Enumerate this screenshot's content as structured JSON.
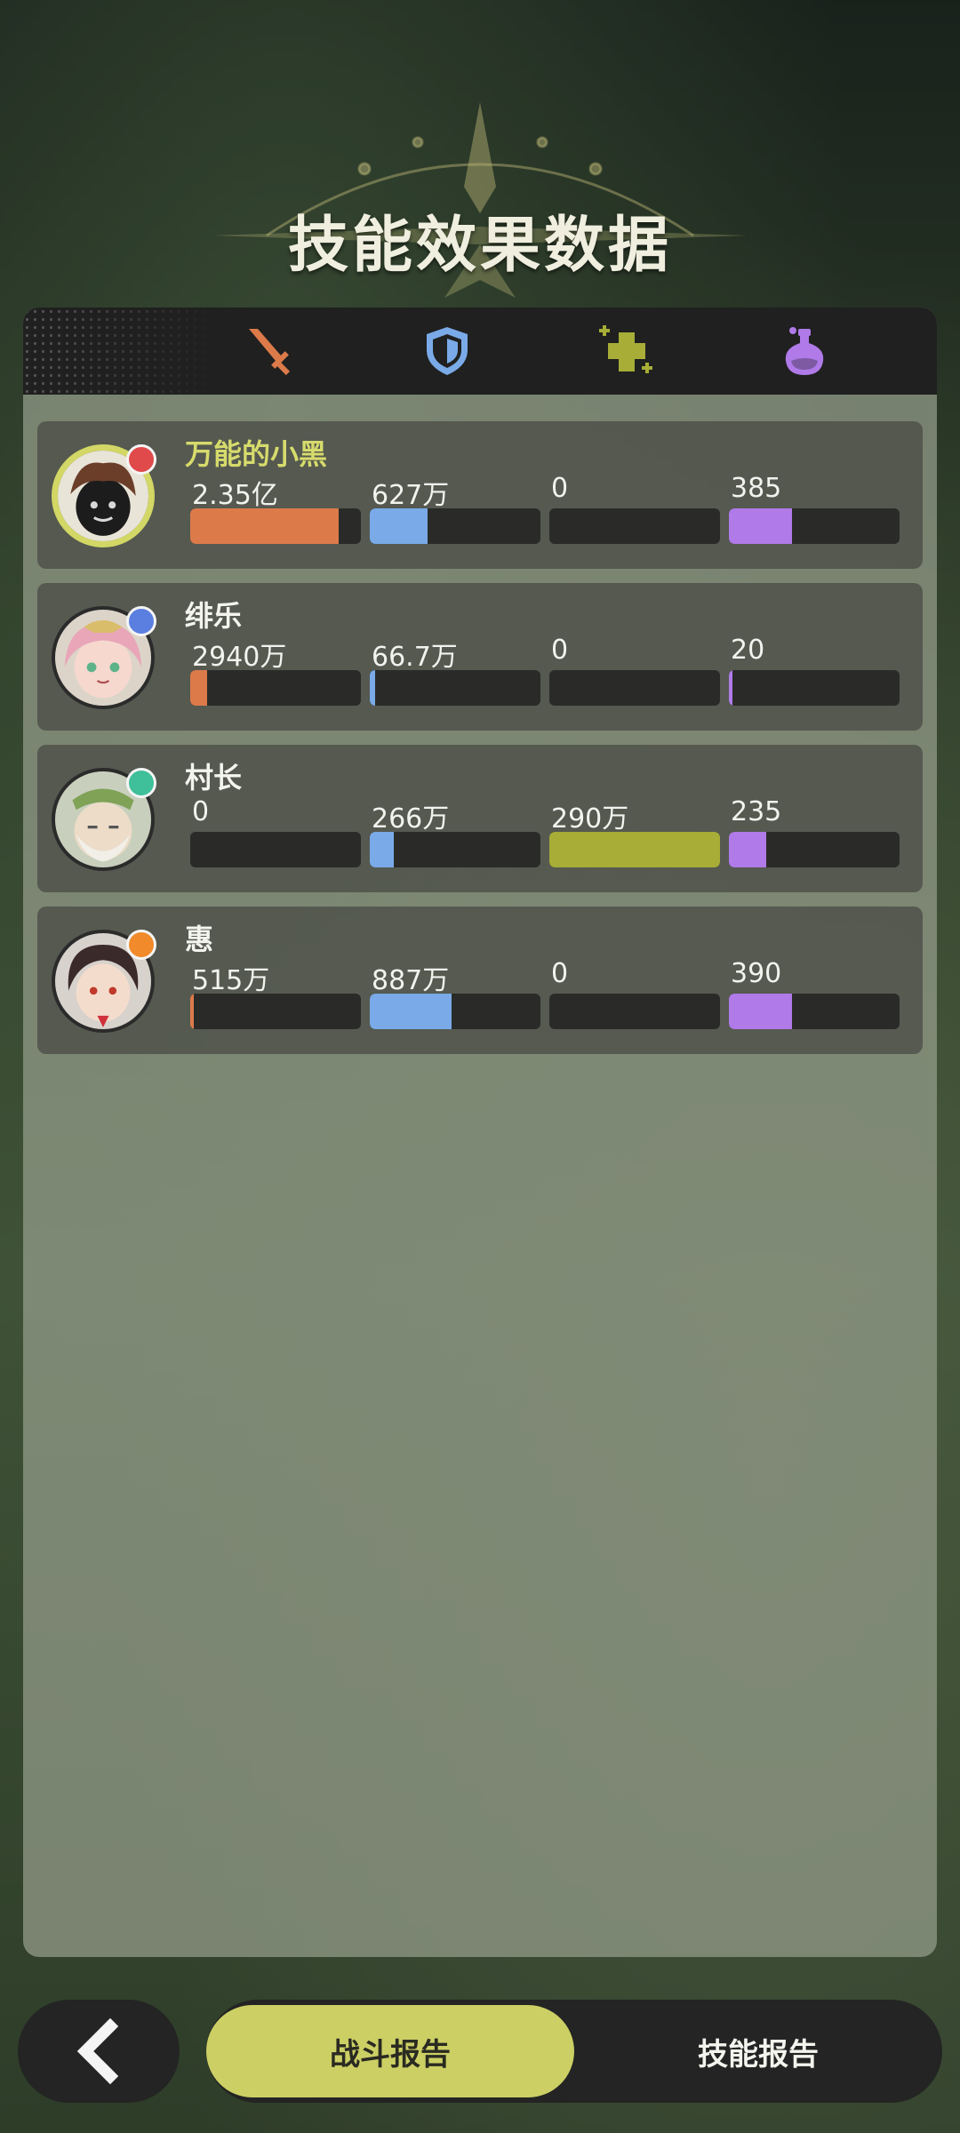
{
  "title": "技能效果数据",
  "colors": {
    "damage": "#dc7a4a",
    "shield": "#7aaae8",
    "heal": "#a7ad36",
    "effect": "#b07ae8",
    "accent": "#cccf64"
  },
  "tabs": [
    {
      "icon": "sword-icon"
    },
    {
      "icon": "shield-icon"
    },
    {
      "icon": "heal-cross-icon"
    },
    {
      "icon": "potion-flask-icon"
    }
  ],
  "rows": [
    {
      "name": "万能的小黑",
      "selected": true,
      "stats": [
        {
          "value": "2.35亿",
          "fill": 0.87
        },
        {
          "value": "627万",
          "fill": 0.34
        },
        {
          "value": "0",
          "fill": 0
        },
        {
          "value": "385",
          "fill": 0.37
        }
      ]
    },
    {
      "name": "绯乐",
      "selected": false,
      "stats": [
        {
          "value": "2940万",
          "fill": 0.1
        },
        {
          "value": "66.7万",
          "fill": 0.03
        },
        {
          "value": "0",
          "fill": 0
        },
        {
          "value": "20",
          "fill": 0.02
        }
      ]
    },
    {
      "name": "村长",
      "selected": false,
      "stats": [
        {
          "value": "0",
          "fill": 0
        },
        {
          "value": "266万",
          "fill": 0.14
        },
        {
          "value": "290万",
          "fill": 1.0
        },
        {
          "value": "235",
          "fill": 0.22
        }
      ]
    },
    {
      "name": "惠",
      "selected": false,
      "stats": [
        {
          "value": "515万",
          "fill": 0.02
        },
        {
          "value": "887万",
          "fill": 0.48
        },
        {
          "value": "0",
          "fill": 0
        },
        {
          "value": "390",
          "fill": 0.37
        }
      ]
    }
  ],
  "bottom": {
    "back_icon": "chevron-left-icon",
    "tab_battle": "战斗报告",
    "tab_skill": "技能报告"
  }
}
